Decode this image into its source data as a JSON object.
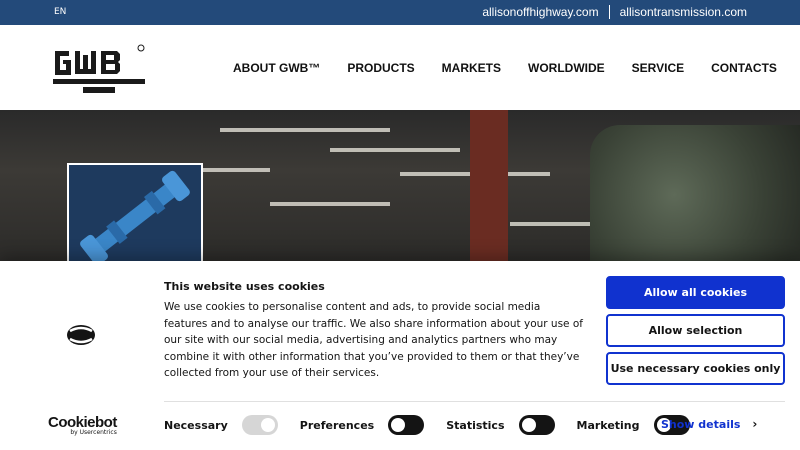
{
  "topbar": {
    "lang": "EN",
    "links": [
      "allisonoffhighway.com",
      "allisontransmission.com"
    ]
  },
  "header": {
    "logo_text": "GWB",
    "nav": [
      "ABOUT GWB™",
      "PRODUCTS",
      "MARKETS",
      "WORLDWIDE",
      "SERVICE",
      "CONTACTS"
    ]
  },
  "cookie": {
    "brand": "Cookiebot",
    "brand_by": "by Usercentrics",
    "title": "This website uses cookies",
    "text": "We use cookies to personalise content and ads, to provide social media features and to analyse our traffic. We also share information about your use of our site with our social media, advertising and analytics partners who may combine it with other information that you’ve provided to them or that they’ve collected from your use of their services.",
    "buttons": {
      "allow_all": "Allow all cookies",
      "allow_selection": "Allow selection",
      "necessary_only": "Use necessary cookies only"
    },
    "toggles": {
      "necessary": "Necessary",
      "preferences": "Preferences",
      "statistics": "Statistics",
      "marketing": "Marketing"
    },
    "details": "Show details"
  },
  "colors": {
    "topbar": "#234a7a",
    "accent": "#1032cf"
  }
}
